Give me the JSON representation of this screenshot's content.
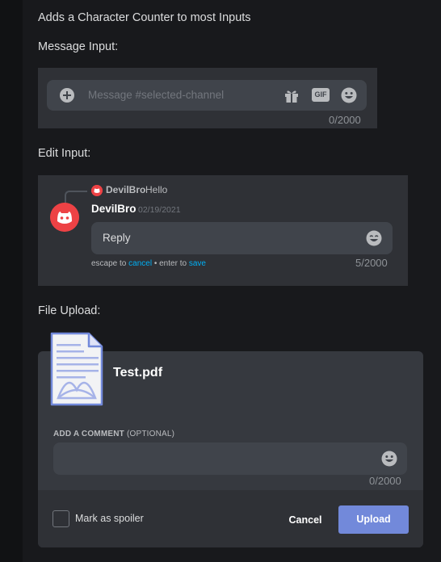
{
  "description": "Adds a Character Counter to most Inputs",
  "message_section": {
    "label": "Message Input:",
    "placeholder": "Message #selected-channel",
    "gif_label": "GIF",
    "counter": "0/2000"
  },
  "edit_section": {
    "label": "Edit Input:",
    "reply": {
      "author": "DevilBro",
      "text": "Hello"
    },
    "author": "DevilBro",
    "timestamp": "02/19/2021",
    "value": "Reply",
    "hint_escape": "escape to ",
    "hint_cancel": "cancel",
    "hint_sep": " • enter to ",
    "hint_save": "save",
    "counter": "5/2000"
  },
  "upload_section": {
    "label": "File Upload:",
    "filename": "Test.pdf",
    "comment_label": "ADD A COMMENT",
    "comment_optional": "(OPTIONAL)",
    "counter": "0/2000",
    "spoiler_label": "Mark as spoiler",
    "cancel_label": "Cancel",
    "upload_label": "Upload"
  },
  "colors": {
    "background": "#18191c",
    "panel": "#2f3136",
    "input": "#40444b",
    "brand": "#7289da",
    "avatar_red": "#ed4245",
    "link": "#00aff4"
  }
}
